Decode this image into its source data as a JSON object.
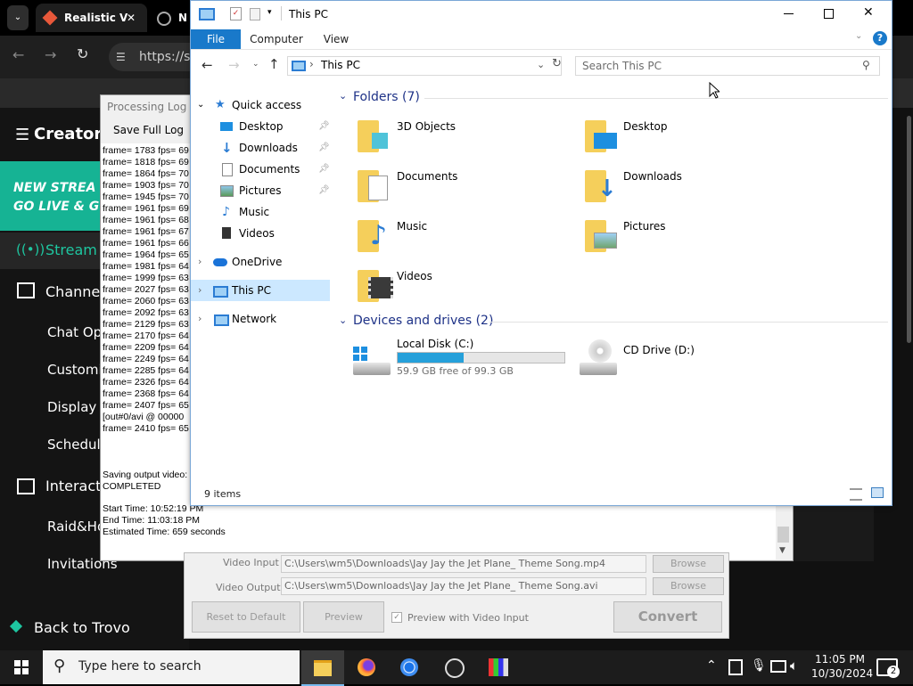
{
  "browser": {
    "tabs": [
      {
        "label": "Realistic V"
      },
      {
        "label": "N"
      }
    ],
    "url": "https://s"
  },
  "creator": {
    "logo": "Creator S",
    "banner": [
      "NEW STREA",
      "GO LIVE & G"
    ],
    "menu": [
      "Stream",
      "Channe",
      "Chat Opt",
      "Customi",
      "Display",
      "Schedule",
      "Interact",
      "Raid&Ho",
      "Invitations"
    ],
    "back": "Back to Trovo"
  },
  "log": {
    "title": "Processing Log C",
    "save_label": "Save Full Log",
    "lines": [
      "frame= 1783 fps= 69",
      "frame= 1818 fps= 69",
      "frame= 1864 fps= 70",
      "frame= 1903 fps= 70",
      "frame= 1945 fps= 70",
      "frame= 1961 fps= 69",
      "frame= 1961 fps= 68",
      "frame= 1961 fps= 67",
      "frame= 1961 fps= 66",
      "frame= 1964 fps= 65",
      "frame= 1981 fps= 64",
      "frame= 1999 fps= 63",
      "frame= 2027 fps= 63",
      "frame= 2060 fps= 63",
      "frame= 2092 fps= 63",
      "frame= 2129 fps= 63",
      "frame= 2170 fps= 64",
      "frame= 2209 fps= 64",
      "frame= 2249 fps= 64",
      "frame= 2285 fps= 64",
      "frame= 2326 fps= 64",
      "frame= 2368 fps= 64",
      "frame= 2407 fps= 65",
      "[out#0/avi @ 00000",
      "frame= 2410 fps= 65"
    ],
    "saving": "Saving output video:",
    "completed": "COMPLETED",
    "start": "Start Time: 10:52:19 PM",
    "end": "End Time: 11:03:18 PM",
    "estimated": "Estimated Time: 659 seconds"
  },
  "converter": {
    "input_label": "Video Input",
    "input_value": "C:\\Users\\wm5\\Downloads\\Jay Jay the Jet Plane_ Theme Song.mp4",
    "output_label": "Video Output:",
    "output_value": "C:\\Users\\wm5\\Downloads\\Jay Jay the Jet Plane_ Theme Song.avi",
    "browse": "Browse",
    "reset": "Reset to Default",
    "preview": "Preview",
    "preview_check": "Preview with Video Input",
    "convert": "Convert"
  },
  "explorer": {
    "title": "This PC",
    "ribbon": [
      "File",
      "Computer",
      "View"
    ],
    "address": "This PC",
    "search_placeholder": "Search This PC",
    "nav": {
      "quick_access": "Quick access",
      "quick_items": [
        "Desktop",
        "Downloads",
        "Documents",
        "Pictures",
        "Music",
        "Videos"
      ],
      "onedrive": "OneDrive",
      "thispc": "This PC",
      "network": "Network"
    },
    "folders_header": "Folders (7)",
    "folders": [
      "3D Objects",
      "Desktop",
      "Documents",
      "Downloads",
      "Music",
      "Pictures",
      "Videos"
    ],
    "devices_header": "Devices and drives (2)",
    "drive_c": {
      "name": "Local Disk (C:)",
      "free": "59.9 GB free of 99.3 GB",
      "used_fraction": 0.397
    },
    "drive_d": {
      "name": "CD Drive (D:)"
    },
    "status": "9 items"
  },
  "taskbar": {
    "search_placeholder": "Type here to search",
    "time": "11:05 PM",
    "date": "10/30/2024",
    "notifications": "2"
  },
  "colors": {
    "accent": "#0063b1",
    "selection": "#cce8ff",
    "drive_bar": "#26a0da"
  }
}
